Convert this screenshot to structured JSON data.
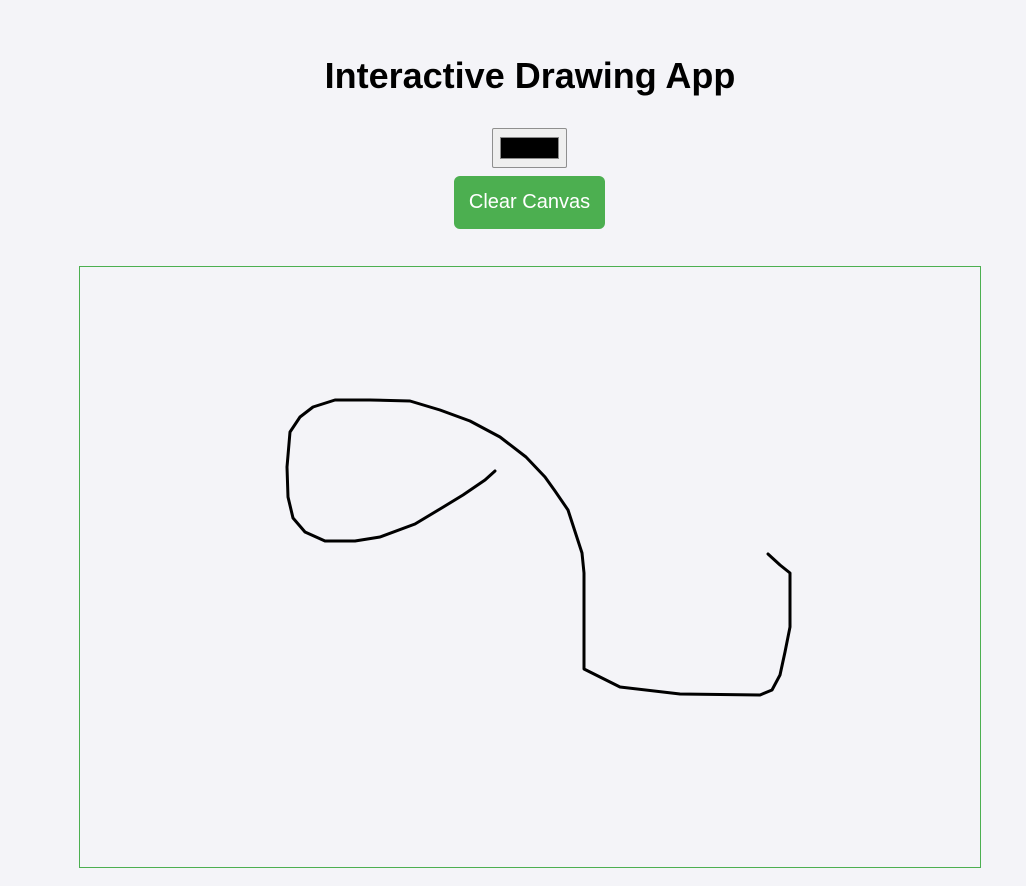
{
  "app": {
    "title": "Interactive Drawing App"
  },
  "toolbar": {
    "color_value": "#000000",
    "clear_label": "Clear Canvas"
  },
  "colors": {
    "accent": "#4caf50",
    "stroke": "#000000",
    "canvas_border": "#4caf50"
  },
  "canvas": {
    "stroke_color": "#000000"
  }
}
